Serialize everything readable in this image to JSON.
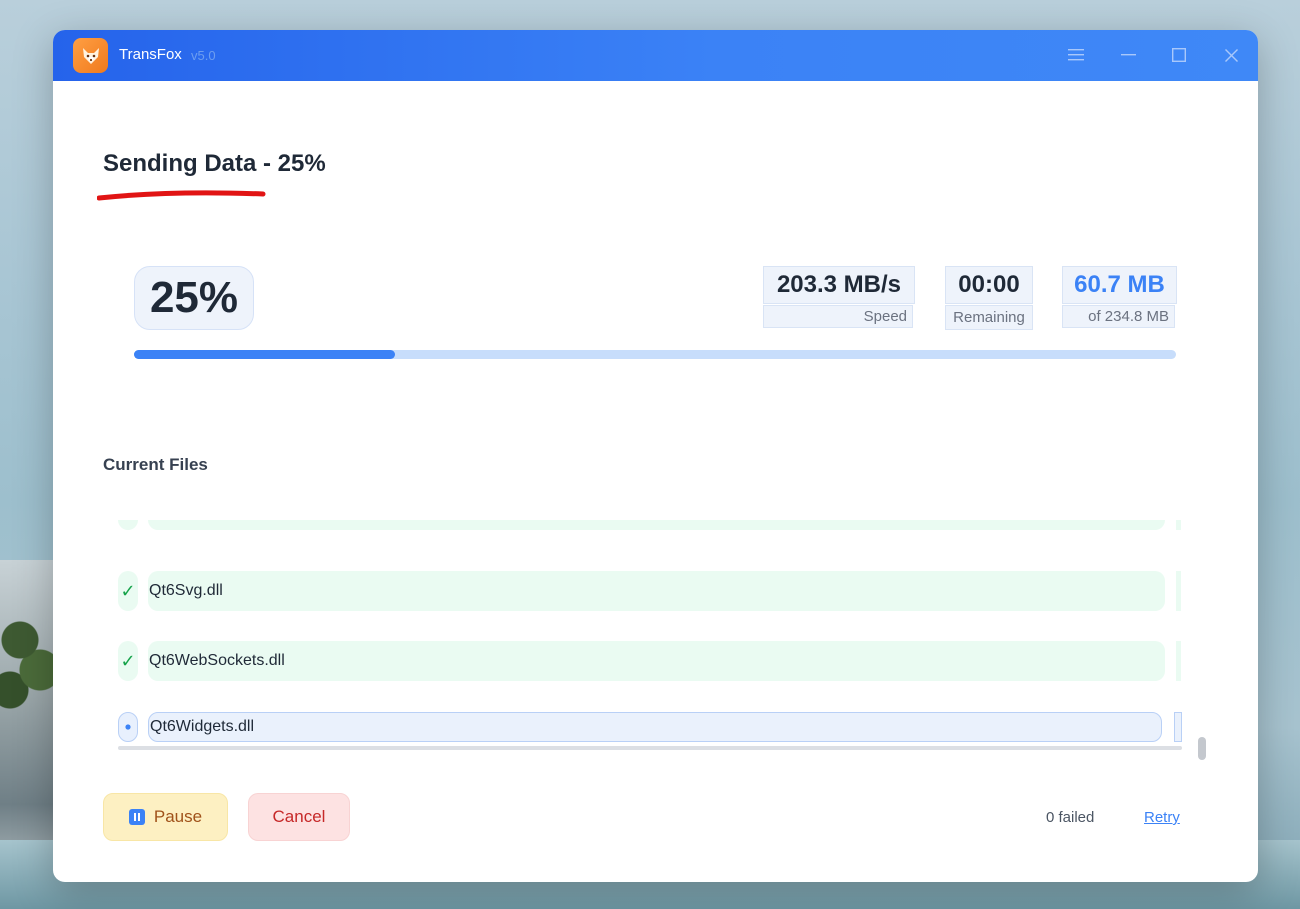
{
  "app": {
    "name": "TransFox",
    "version": "v5.0"
  },
  "window_controls": {
    "menu_icon": "hamburger-menu-icon",
    "minimize_icon": "minimize-icon",
    "maximize_icon": "maximize-icon",
    "close_icon": "close-icon"
  },
  "heading": "Sending Data - 25%",
  "progress": {
    "percent_label": "25%",
    "fraction": 0.25,
    "speed_value": "203.3 MB/s",
    "speed_label": "Speed",
    "remaining_value": "00:00",
    "remaining_label": "Remaining",
    "transferred_value": "60.7 MB",
    "transferred_label": "of 234.8 MB"
  },
  "files": {
    "title": "Current Files",
    "items": [
      {
        "name": "",
        "status": "done"
      },
      {
        "name": "Qt6Svg.dll",
        "status": "done"
      },
      {
        "name": "Qt6WebSockets.dll",
        "status": "done"
      },
      {
        "name": "Qt6Widgets.dll",
        "status": "active"
      }
    ]
  },
  "footer": {
    "pause_label": "Pause",
    "cancel_label": "Cancel",
    "failed_text": "0 failed",
    "retry_label": "Retry"
  },
  "colors": {
    "titlebar": "#3b82f6",
    "accent": "#3b82f6",
    "success": "#16a34a",
    "danger": "#c62828",
    "warning_bg": "#fdf0c2"
  }
}
